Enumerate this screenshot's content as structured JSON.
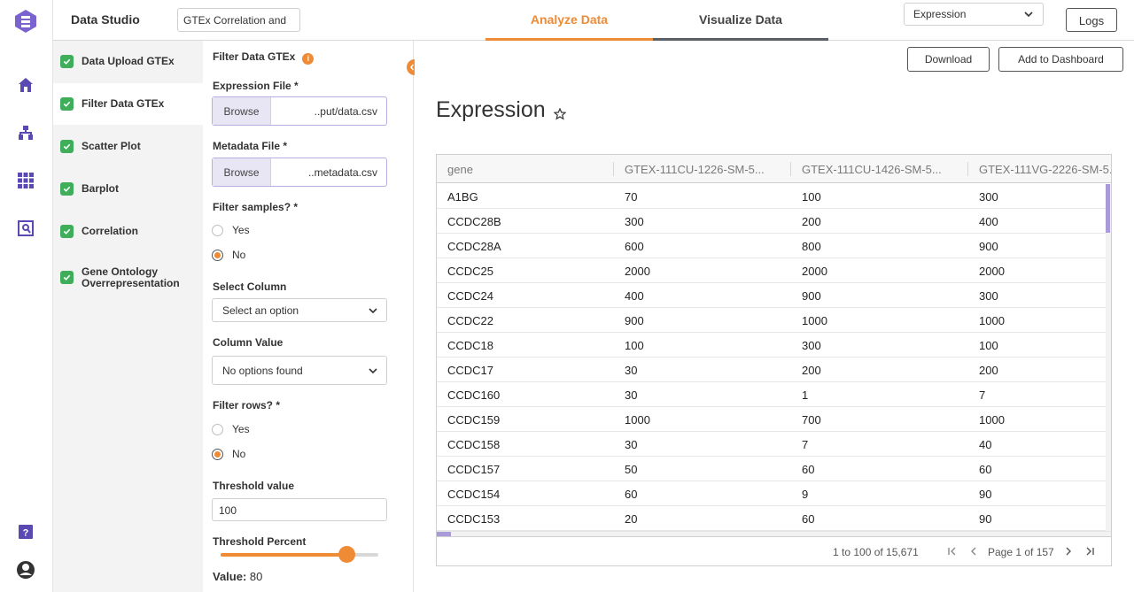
{
  "header": {
    "app_title": "Data Studio",
    "project_name": "GTEx Correlation and",
    "tabs": [
      {
        "label": "Analyze Data",
        "active": true
      },
      {
        "label": "Visualize Data",
        "active": false
      }
    ],
    "view_select": "Expression",
    "logs_label": "Logs"
  },
  "rail": {
    "icons": [
      "logo-icon",
      "home-icon",
      "workflow-icon",
      "apps-grid-icon",
      "search-data-icon",
      "help-icon",
      "user-icon"
    ]
  },
  "steps": [
    {
      "label": "Data Upload GTEx",
      "done": true,
      "active": false
    },
    {
      "label": "Filter Data GTEx",
      "done": true,
      "active": true
    },
    {
      "label": "Scatter Plot",
      "done": true,
      "active": false
    },
    {
      "label": "Barplot",
      "done": true,
      "active": false
    },
    {
      "label": "Correlation",
      "done": true,
      "active": false
    },
    {
      "label": "Gene Ontology Overrepresentation",
      "done": true,
      "active": false
    }
  ],
  "form": {
    "title": "Filter Data GTEx",
    "info_glyph": "i",
    "expression_file": {
      "label": "Expression File *",
      "browse": "Browse",
      "value": "..put/data.csv"
    },
    "metadata_file": {
      "label": "Metadata File *",
      "browse": "Browse",
      "value": "..metadata.csv"
    },
    "filter_samples": {
      "label": "Filter samples? *",
      "options": [
        "Yes",
        "No"
      ],
      "selected": "No"
    },
    "select_column": {
      "label": "Select Column",
      "value": "Select an option"
    },
    "column_value": {
      "label": "Column Value",
      "value": "No options found"
    },
    "filter_rows": {
      "label": "Filter rows? *",
      "options": [
        "Yes",
        "No"
      ],
      "selected": "No"
    },
    "threshold_value": {
      "label": "Threshold value",
      "value": "100"
    },
    "threshold_percent": {
      "label": "Threshold Percent",
      "value_label": "Value:",
      "value": "80",
      "fraction": 0.8
    }
  },
  "main": {
    "download_label": "Download",
    "dashboard_label": "Add to Dashboard",
    "title": "Expression",
    "columns": [
      "gene",
      "GTEX-111CU-1226-SM-5...",
      "GTEX-111CU-1426-SM-5...",
      "GTEX-111VG-2226-SM-5..."
    ],
    "rows": [
      [
        "A1BG",
        "70",
        "100",
        "300"
      ],
      [
        "CCDC28B",
        "300",
        "200",
        "400"
      ],
      [
        "CCDC28A",
        "600",
        "800",
        "900"
      ],
      [
        "CCDC25",
        "2000",
        "2000",
        "2000"
      ],
      [
        "CCDC24",
        "400",
        "900",
        "300"
      ],
      [
        "CCDC22",
        "900",
        "1000",
        "1000"
      ],
      [
        "CCDC18",
        "100",
        "300",
        "100"
      ],
      [
        "CCDC17",
        "30",
        "200",
        "200"
      ],
      [
        "CCDC160",
        "30",
        "1",
        "7"
      ],
      [
        "CCDC159",
        "1000",
        "700",
        "1000"
      ],
      [
        "CCDC158",
        "30",
        "7",
        "40"
      ],
      [
        "CCDC157",
        "50",
        "60",
        "60"
      ],
      [
        "CCDC154",
        "60",
        "9",
        "90"
      ],
      [
        "CCDC153",
        "20",
        "60",
        "90"
      ]
    ],
    "pager": {
      "count": "1 to 100 of 15,671",
      "page": "Page 1 of 157"
    }
  },
  "colors": {
    "accent": "#ef8a35",
    "brand": "#6f5bc5",
    "success": "#3fae5a"
  }
}
